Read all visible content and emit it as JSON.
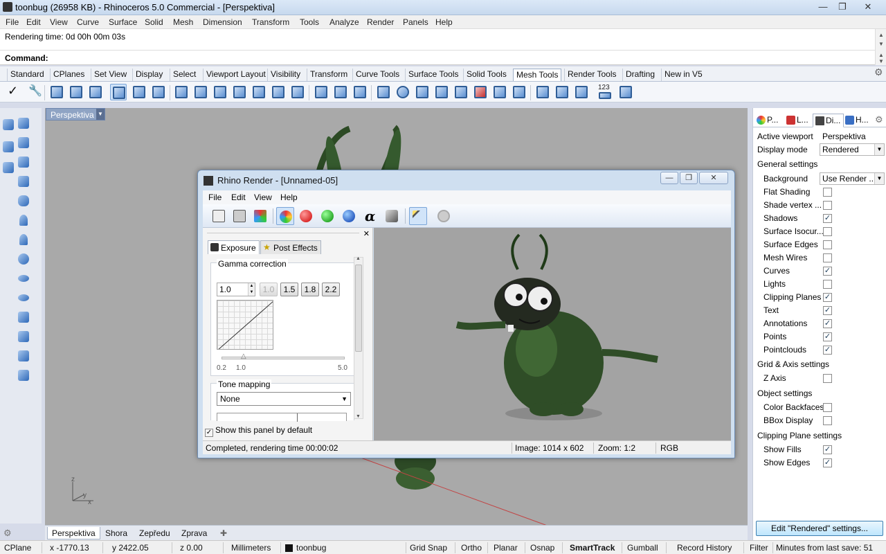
{
  "window": {
    "title": "toonbug (26958 KB) - Rhinoceros 5.0 Commercial - [Perspektiva]"
  },
  "menu": [
    "File",
    "Edit",
    "View",
    "Curve",
    "Surface",
    "Solid",
    "Mesh",
    "Dimension",
    "Transform",
    "Tools",
    "Analyze",
    "Render",
    "Panels",
    "Help"
  ],
  "command": {
    "history": "Rendering time: 0d 00h 00m 03s",
    "label": "Command:"
  },
  "toolbar_tabs": [
    "Standard",
    "CPlanes",
    "Set View",
    "Display",
    "Select",
    "Viewport Layout",
    "Visibility",
    "Transform",
    "Curve Tools",
    "Surface Tools",
    "Solid Tools",
    "Mesh Tools",
    "Render Tools",
    "Drafting",
    "New in V5"
  ],
  "active_toolbar_tab": "Mesh Tools",
  "toolbar_icons": [
    "checkmark-icon",
    "wrench-icon",
    "mesh-icon"
  ],
  "mesh_toolbar_number_label": "123",
  "viewport": {
    "name": "Perspektiva",
    "axis_z": "z",
    "axis_y": "y",
    "axis_x": "x"
  },
  "viewport_tabs": [
    "Perspektiva",
    "Shora",
    "Zepředu",
    "Zprava"
  ],
  "add_tab_glyph": "✚",
  "right_panel": {
    "tabs": [
      "P...",
      "L...",
      "Di...",
      "H..."
    ],
    "active_viewport_label": "Active viewport",
    "active_viewport_value": "Perspektiva",
    "display_mode_label": "Display mode",
    "display_mode_value": "Rendered",
    "general_settings": "General settings",
    "background_label": "Background",
    "background_value": "Use Render ...",
    "general_items": [
      {
        "label": "Flat Shading",
        "checked": false
      },
      {
        "label": "Shade vertex ...",
        "checked": false
      },
      {
        "label": "Shadows",
        "checked": true
      },
      {
        "label": "Surface Isocur...",
        "checked": false
      },
      {
        "label": "Surface Edges",
        "checked": false
      },
      {
        "label": "Mesh Wires",
        "checked": false
      },
      {
        "label": "Curves",
        "checked": true
      },
      {
        "label": "Lights",
        "checked": false
      },
      {
        "label": "Clipping Planes",
        "checked": true
      },
      {
        "label": "Text",
        "checked": true
      },
      {
        "label": "Annotations",
        "checked": true
      },
      {
        "label": "Points",
        "checked": true
      },
      {
        "label": "Pointclouds",
        "checked": true
      }
    ],
    "grid_axis_settings": "Grid & Axis settings",
    "z_axis": {
      "label": "Z Axis",
      "checked": false
    },
    "object_settings": "Object settings",
    "object_items": [
      {
        "label": "Color Backfaces",
        "checked": false
      },
      {
        "label": "BBox Display",
        "checked": false
      }
    ],
    "clipping_plane_settings": "Clipping Plane settings",
    "clipping_items": [
      {
        "label": "Show Fills",
        "checked": true
      },
      {
        "label": "Show Edges",
        "checked": true
      }
    ],
    "edit_button": "Edit \"Rendered\" settings..."
  },
  "status": {
    "cplane": "CPlane",
    "x": "x -1770.13",
    "y": "y 2422.05",
    "z": "z 0.00",
    "units": "Millimeters",
    "layer": "toonbug",
    "grid_snap": "Grid Snap",
    "ortho": "Ortho",
    "planar": "Planar",
    "osnap": "Osnap",
    "smarttrack": "SmartTrack",
    "gumball": "Gumball",
    "record_history": "Record History",
    "filter": "Filter",
    "minutes": "Minutes from last save: 51"
  },
  "render_window": {
    "title": "Rhino Render - [Unnamed-05]",
    "menu": [
      "File",
      "Edit",
      "View",
      "Help"
    ],
    "alpha_glyph": "α",
    "tabs": [
      "Exposure",
      "Post Effects"
    ],
    "gamma": {
      "label": "Gamma correction",
      "value": "1.0",
      "presets": [
        "1.0",
        "1.5",
        "1.8",
        "2.2"
      ],
      "slider_min": "0.2",
      "slider_current": "1.0",
      "slider_max": "5.0",
      "slider_fraction": 0.04
    },
    "tone_mapping": {
      "label": "Tone mapping",
      "value": "None"
    },
    "show_default": "Show this panel by default",
    "status_text": "Completed, rendering time 00:00:02",
    "image_size": "Image: 1014 x 602",
    "zoom": "Zoom: 1:2",
    "channel": "RGB"
  }
}
